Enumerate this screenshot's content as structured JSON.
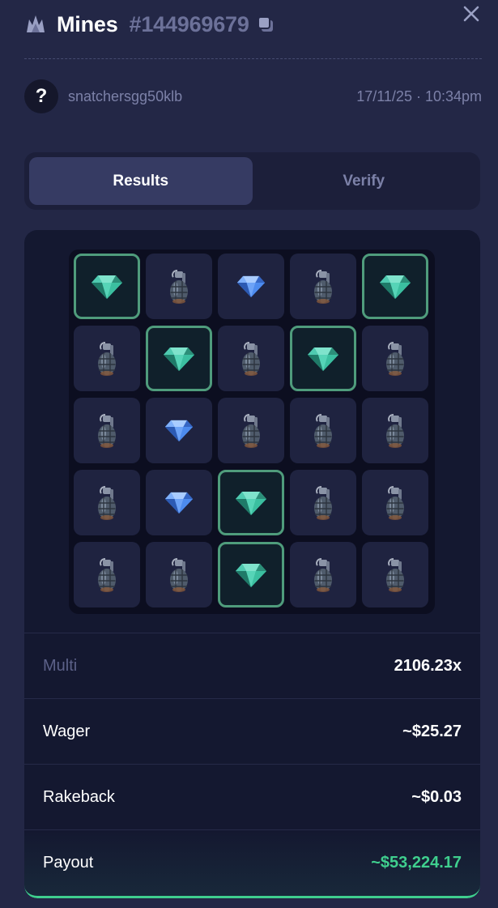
{
  "header": {
    "game_icon": "mines-game-icon",
    "title": "Mines",
    "bet_id": "#144969679",
    "copy_icon": "copy-icon",
    "close_icon": "close-icon"
  },
  "user": {
    "avatar_glyph": "?",
    "username": "snatchersgg50klb",
    "datetime": "17/11/25 · 10:34pm"
  },
  "tabs": [
    {
      "label": "Results",
      "active": true
    },
    {
      "label": "Verify",
      "active": false
    }
  ],
  "board": {
    "rows": [
      [
        "gem-picked",
        "mine",
        "gem",
        "mine",
        "gem-picked"
      ],
      [
        "mine",
        "gem-picked",
        "mine",
        "gem-picked",
        "mine"
      ],
      [
        "mine",
        "gem",
        "mine",
        "mine",
        "mine"
      ],
      [
        "mine",
        "gem",
        "gem-picked",
        "mine",
        "mine"
      ],
      [
        "mine",
        "mine",
        "gem-picked",
        "mine",
        "mine"
      ]
    ]
  },
  "stats": {
    "multi_label": "Multi",
    "multi_value": "2106.23x",
    "wager_label": "Wager",
    "wager_value": "~$25.27",
    "rakeback_label": "Rakeback",
    "rakeback_value": "~$0.03",
    "payout_label": "Payout",
    "payout_value": "~$53,224.17"
  },
  "colors": {
    "background": "#232746",
    "panel": "#141830",
    "tile": "#1f2340",
    "picked_border": "#4f9c7c",
    "payout_green": "#3fcf8e",
    "muted_text": "#7c81a8"
  }
}
